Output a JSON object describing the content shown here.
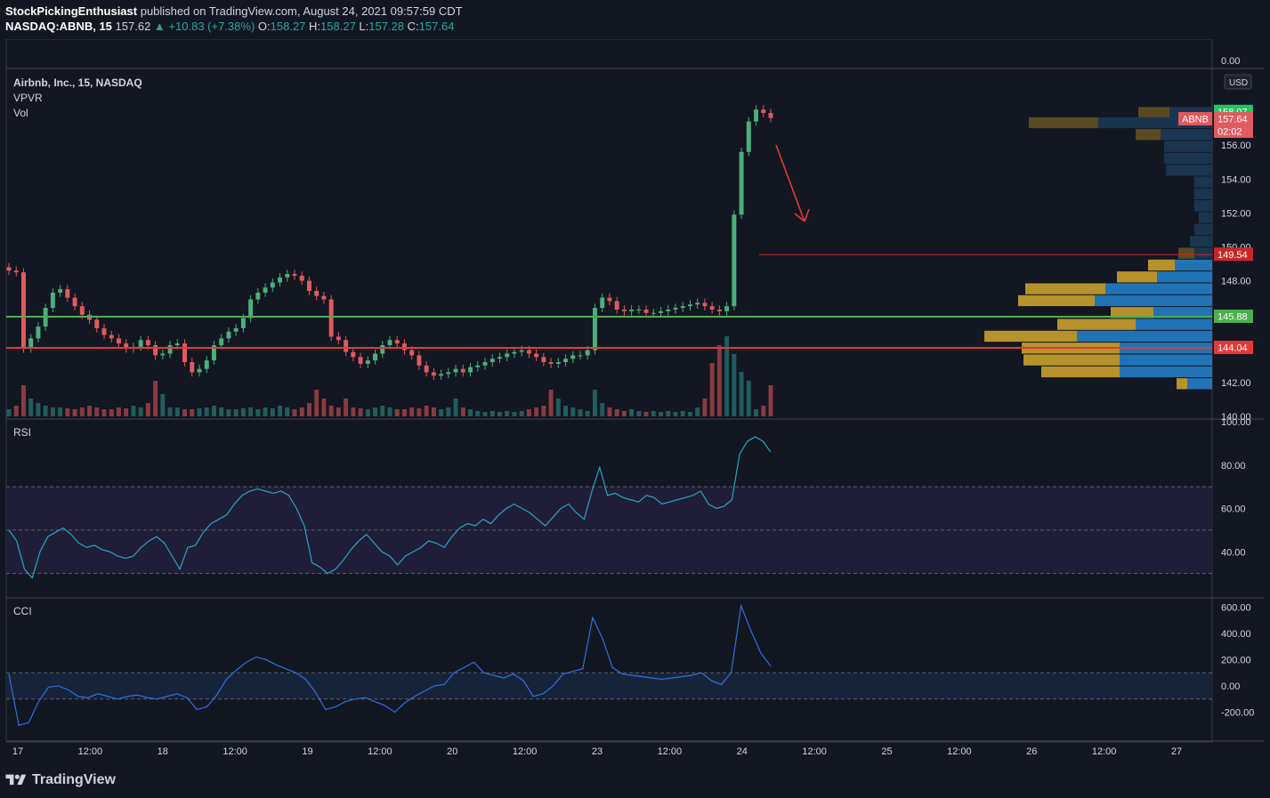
{
  "header": {
    "author": "StockPickingEnthusiast",
    "published": "published on TradingView.com, August 24, 2021 09:57:59 CDT",
    "symbol": "NASDAQ:ABNB, 15",
    "last": "157.62",
    "arrow": "▲",
    "change": "+10.83 (+7.38%)",
    "o_label": "O:",
    "o": "158.27",
    "h_label": "H:",
    "h": "158.27",
    "l_label": "L:",
    "l": "157.28",
    "c_label": "C:",
    "c": "157.64"
  },
  "legend": {
    "title": "Airbnb, Inc., 15, NASDAQ",
    "vpvr": "VPVR",
    "vol": "Vol",
    "rsi": "RSI",
    "cci": "CCI"
  },
  "footer": {
    "brand": "TradingView"
  },
  "colors": {
    "bg": "#131722",
    "up": "#4caf7d",
    "down": "#e05a5e",
    "vol_up": "#1f5e5a",
    "vol_down": "#8a3b40",
    "green_line": "#4caf50",
    "red_line": "#e53935",
    "rsi": "#29a3c6",
    "cci": "#2f6fe0",
    "vp_blue": "#2273b5",
    "vp_gold": "#b5922c",
    "vp_blue_dim": "#1a3550",
    "vp_gold_dim": "#5a4a22"
  },
  "chart_data": {
    "type": "candlestick",
    "price_axis": {
      "ylim": [
        140,
        160
      ],
      "ticks": [
        "0.00",
        "156.00",
        "154.00",
        "152.00",
        "150.00",
        "148.00",
        "142.00",
        "140.00"
      ],
      "currency": "USD"
    },
    "x_ticks": [
      "17",
      "12:00",
      "18",
      "12:00",
      "19",
      "12:00",
      "20",
      "12:00",
      "23",
      "12:00",
      "24",
      "12:00",
      "25",
      "12:00",
      "26",
      "12:00",
      "27"
    ],
    "price_labels": [
      {
        "text": "158.07",
        "value": 158.07,
        "color": "#22c55e"
      },
      {
        "text": "ABNB",
        "value": 157.64,
        "color": "#e05a5e"
      },
      {
        "text": "157.64",
        "value": 157.64,
        "color": "#e05a5e"
      },
      {
        "text": "02:02",
        "value": 157.64,
        "color": "#e05a5e"
      },
      {
        "text": "149.54",
        "value": 149.54,
        "color": "#c62828"
      },
      {
        "text": "145.88",
        "value": 145.88,
        "color": "#4caf50"
      },
      {
        "text": "144.04",
        "value": 144.04,
        "color": "#e53935"
      }
    ],
    "hlines": [
      {
        "value": 145.88,
        "color": "#4caf50"
      },
      {
        "value": 144.04,
        "color": "#e53935"
      },
      {
        "value": 149.54,
        "color": "#c62828",
        "thin": true
      }
    ],
    "close_path": [
      148.6,
      148.5,
      144.0,
      144.6,
      145.3,
      146.4,
      147.3,
      147.5,
      147.0,
      146.5,
      146.0,
      145.7,
      145.2,
      144.8,
      144.6,
      144.3,
      144.0,
      144.1,
      144.5,
      144.2,
      143.6,
      143.7,
      144.2,
      144.3,
      143.2,
      142.6,
      142.8,
      143.3,
      144.2,
      144.6,
      145.0,
      145.2,
      145.8,
      146.9,
      147.3,
      147.6,
      147.9,
      148.2,
      148.4,
      148.3,
      148.0,
      147.4,
      147.1,
      146.9,
      144.7,
      144.5,
      143.8,
      143.5,
      143.1,
      143.3,
      143.7,
      144.2,
      144.5,
      144.3,
      143.9,
      143.6,
      143.0,
      142.6,
      142.4,
      142.5,
      142.6,
      142.8,
      142.6,
      142.9,
      143.0,
      143.2,
      143.4,
      143.5,
      143.7,
      143.8,
      143.9,
      143.7,
      143.5,
      143.2,
      143.1,
      143.2,
      143.4,
      143.6,
      143.6,
      143.9,
      146.4,
      147.0,
      146.8,
      146.3,
      146.2,
      146.3,
      146.3,
      146.1,
      146.1,
      146.2,
      146.3,
      146.4,
      146.5,
      146.6,
      146.7,
      146.5,
      146.3,
      146.2,
      146.5,
      151.9,
      155.6,
      157.4,
      158.1,
      157.9,
      157.6
    ],
    "volume_relative": [
      0.08,
      0.12,
      0.35,
      0.2,
      0.15,
      0.12,
      0.1,
      0.1,
      0.09,
      0.08,
      0.1,
      0.12,
      0.1,
      0.08,
      0.08,
      0.1,
      0.09,
      0.12,
      0.1,
      0.15,
      0.4,
      0.25,
      0.1,
      0.1,
      0.08,
      0.08,
      0.09,
      0.1,
      0.12,
      0.1,
      0.08,
      0.08,
      0.09,
      0.1,
      0.08,
      0.1,
      0.09,
      0.12,
      0.1,
      0.08,
      0.1,
      0.15,
      0.3,
      0.2,
      0.12,
      0.1,
      0.2,
      0.1,
      0.09,
      0.08,
      0.1,
      0.12,
      0.1,
      0.08,
      0.08,
      0.1,
      0.09,
      0.12,
      0.1,
      0.08,
      0.1,
      0.2,
      0.1,
      0.08,
      0.06,
      0.05,
      0.06,
      0.05,
      0.06,
      0.05,
      0.06,
      0.08,
      0.1,
      0.12,
      0.3,
      0.2,
      0.12,
      0.1,
      0.08,
      0.06,
      0.3,
      0.15,
      0.1,
      0.08,
      0.06,
      0.08,
      0.06,
      0.05,
      0.06,
      0.05,
      0.06,
      0.05,
      0.06,
      0.05,
      0.1,
      0.2,
      0.6,
      0.8,
      0.9,
      0.7,
      0.5,
      0.4
    ],
    "vpvr": [
      {
        "price": 157.9,
        "up": 48,
        "down": 35
      },
      {
        "price": 157.3,
        "up": 128,
        "down": 78
      },
      {
        "price": 156.6,
        "up": 58,
        "down": 28
      },
      {
        "price": 155.9,
        "up": 54,
        "down": 0
      },
      {
        "price": 155.2,
        "up": 54,
        "down": 0
      },
      {
        "price": 154.5,
        "up": 52,
        "down": 0
      },
      {
        "price": 153.8,
        "up": 20,
        "down": 0
      },
      {
        "price": 153.1,
        "up": 20,
        "down": 0
      },
      {
        "price": 152.4,
        "up": 20,
        "down": 0
      },
      {
        "price": 151.7,
        "up": 15,
        "down": 0
      },
      {
        "price": 151.0,
        "up": 20,
        "down": 0
      },
      {
        "price": 150.3,
        "up": 25,
        "down": 0
      },
      {
        "price": 149.6,
        "up": 20,
        "down": 18
      },
      {
        "price": 148.9,
        "up": 42,
        "down": 30
      },
      {
        "price": 148.2,
        "up": 62,
        "down": 45
      },
      {
        "price": 147.5,
        "up": 120,
        "down": 90
      },
      {
        "price": 146.8,
        "up": 132,
        "down": 86
      },
      {
        "price": 146.1,
        "up": 66,
        "down": 48
      },
      {
        "price": 145.4,
        "up": 86,
        "down": 88
      },
      {
        "price": 144.7,
        "up": 152,
        "down": 104
      },
      {
        "price": 144.0,
        "up": 104,
        "down": 110
      },
      {
        "price": 143.3,
        "up": 104,
        "down": 108
      },
      {
        "price": 142.6,
        "up": 104,
        "down": 88
      },
      {
        "price": 141.9,
        "up": 28,
        "down": 12
      }
    ],
    "rsi": {
      "ylim": [
        20,
        100
      ],
      "ticks": [
        "100.00",
        "80.00",
        "60.00",
        "40.00"
      ],
      "band": [
        30,
        70
      ],
      "values": [
        50,
        45,
        32,
        28,
        40,
        47,
        49,
        51,
        48,
        44,
        42,
        43,
        41,
        40,
        38,
        37,
        38,
        42,
        45,
        47,
        44,
        38,
        32,
        42,
        43,
        49,
        53,
        55,
        57,
        62,
        66,
        68,
        69,
        68,
        67,
        68,
        66,
        60,
        52,
        35,
        33,
        30,
        32,
        36,
        41,
        45,
        48,
        44,
        40,
        38,
        34,
        38,
        40,
        42,
        45,
        44,
        42,
        47,
        51,
        53,
        52,
        55,
        53,
        57,
        60,
        62,
        60,
        58,
        55,
        52,
        56,
        60,
        62,
        58,
        55,
        68,
        79,
        66,
        67,
        65,
        64,
        63,
        66,
        65,
        62,
        63,
        64,
        65,
        66,
        68,
        62,
        60,
        61,
        64,
        85,
        91,
        93,
        91,
        86
      ]
    },
    "cci": {
      "ylim": [
        -400,
        650
      ],
      "ticks": [
        "600.00",
        "400.00",
        "200.00",
        "0.00",
        "-200.00"
      ],
      "band": [
        -100,
        100
      ],
      "values": [
        90,
        -300,
        -280,
        -120,
        -10,
        0,
        -30,
        -80,
        -90,
        -60,
        -80,
        -100,
        -80,
        -70,
        -90,
        -100,
        -80,
        -60,
        -90,
        -180,
        -160,
        -70,
        50,
        120,
        180,
        220,
        200,
        160,
        130,
        100,
        50,
        -50,
        -180,
        -160,
        -120,
        -100,
        -90,
        -120,
        -150,
        -200,
        -130,
        -80,
        -40,
        0,
        10,
        100,
        140,
        180,
        100,
        80,
        60,
        90,
        40,
        -80,
        -60,
        0,
        90,
        110,
        130,
        520,
        360,
        140,
        90,
        80,
        70,
        60,
        50,
        60,
        70,
        80,
        100,
        40,
        10,
        100,
        610,
        420,
        250,
        150
      ]
    }
  }
}
